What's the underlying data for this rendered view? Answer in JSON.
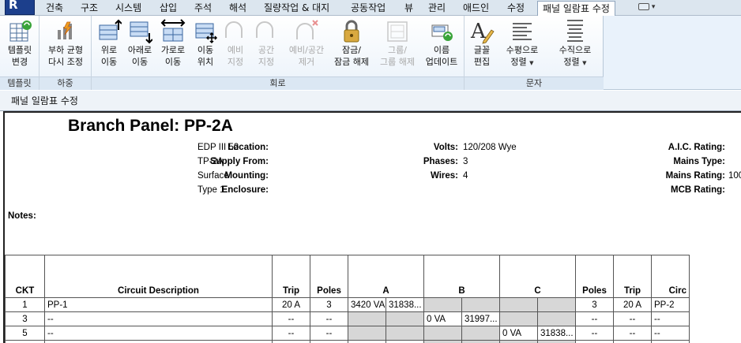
{
  "tabs": [
    "건축",
    "구조",
    "시스템",
    "삽입",
    "주석",
    "해석",
    "질량작업 & 대지",
    "공동작업",
    "뷰",
    "관리",
    "애드인",
    "수정",
    "패널 일람표 수정"
  ],
  "active_tab": "패널 일람표 수정",
  "ribbon": {
    "groups": [
      {
        "label": "템플릿",
        "buttons": [
          {
            "line1": "템플릿",
            "line2": "변경",
            "icon": "template-change-icon",
            "enabled": true
          }
        ]
      },
      {
        "label": "하중",
        "buttons": [
          {
            "line1": "부하 균형",
            "line2": "다시 조정",
            "icon": "load-rebalance-icon",
            "enabled": true
          }
        ]
      },
      {
        "label": "회로",
        "buttons": [
          {
            "line1": "위로",
            "line2": "이동",
            "icon": "move-up-icon",
            "enabled": true
          },
          {
            "line1": "아래로",
            "line2": "이동",
            "icon": "move-down-icon",
            "enabled": true
          },
          {
            "line1": "가로로",
            "line2": "이동",
            "icon": "move-across-icon",
            "enabled": true
          },
          {
            "line1": "이동",
            "line2": "위치",
            "icon": "move-to-icon",
            "enabled": true
          },
          {
            "line1": "예비",
            "line2": "지정",
            "icon": "assign-spare-icon",
            "enabled": false
          },
          {
            "line1": "공간",
            "line2": "지정",
            "icon": "assign-space-icon",
            "enabled": false
          },
          {
            "line1": "예비/공간",
            "line2": "제거",
            "icon": "remove-spare-space-icon",
            "enabled": false
          },
          {
            "line1": "잠금/",
            "line2": "잠금 해제",
            "icon": "lock-icon",
            "enabled": true
          },
          {
            "line1": "그룹/",
            "line2": "그룹 해제",
            "icon": "group-icon",
            "enabled": false
          },
          {
            "line1": "이름",
            "line2": "업데이트",
            "icon": "update-names-icon",
            "enabled": true
          }
        ]
      },
      {
        "label": "문자",
        "buttons": [
          {
            "line1": "글꼴",
            "line2": "편집",
            "icon": "edit-font-icon",
            "enabled": true
          },
          {
            "line1": "수평으로",
            "line2": "정렬",
            "icon": "align-horizontal-icon",
            "enabled": true
          },
          {
            "line1": "수직으로",
            "line2": "정렬",
            "icon": "align-vertical-icon",
            "enabled": true
          }
        ]
      }
    ]
  },
  "panel_title": "패널 일람표 수정",
  "schedule": {
    "title": "Branch Panel: PP-2A",
    "fields_left": [
      {
        "label": "Location:",
        "value": "EDP III 52"
      },
      {
        "label": "Supply From:",
        "value": "TP-2A"
      },
      {
        "label": "Mounting:",
        "value": "Surface"
      },
      {
        "label": "Enclosure:",
        "value": "Type 1"
      }
    ],
    "fields_mid": [
      {
        "label": "Volts:",
        "value": "120/208 Wye"
      },
      {
        "label": "Phases:",
        "value": "3"
      },
      {
        "label": "Wires:",
        "value": "4"
      }
    ],
    "fields_right": [
      {
        "label": "A.I.C. Rating:",
        "value": ""
      },
      {
        "label": "Mains Type:",
        "value": ""
      },
      {
        "label": "Mains Rating:",
        "value": "100"
      },
      {
        "label": "MCB Rating:",
        "value": ""
      }
    ],
    "notes_label": "Notes:",
    "headers": [
      "CKT",
      "Circuit Description",
      "Trip",
      "Poles",
      "A",
      "B",
      "C",
      "Poles",
      "Trip",
      "Circ"
    ],
    "rows": [
      {
        "ckt": "1",
        "desc": "PP-1",
        "trip": "20 A",
        "poles": "3",
        "a1": "3420 VA",
        "a2": "31838...",
        "b1": "",
        "b2": "",
        "c1": "",
        "c2": "",
        "poles2": "3",
        "trip2": "20 A",
        "desc2": "PP-2"
      },
      {
        "ckt": "3",
        "desc": "--",
        "trip": "--",
        "poles": "--",
        "a1": "",
        "a2": "",
        "b1": "0 VA",
        "b2": "31997...",
        "c1": "",
        "c2": "",
        "poles2": "--",
        "trip2": "--",
        "desc2": "--"
      },
      {
        "ckt": "5",
        "desc": "--",
        "trip": "--",
        "poles": "--",
        "a1": "",
        "a2": "",
        "b1": "",
        "b2": "",
        "c1": "0 VA",
        "c2": "31838...",
        "poles2": "--",
        "trip2": "--",
        "desc2": "--"
      }
    ]
  },
  "colors": {
    "accent": "#1c3f8c",
    "ribbon_bg": "#e9f2fb",
    "shaded_cell": "#d7d7d7"
  }
}
